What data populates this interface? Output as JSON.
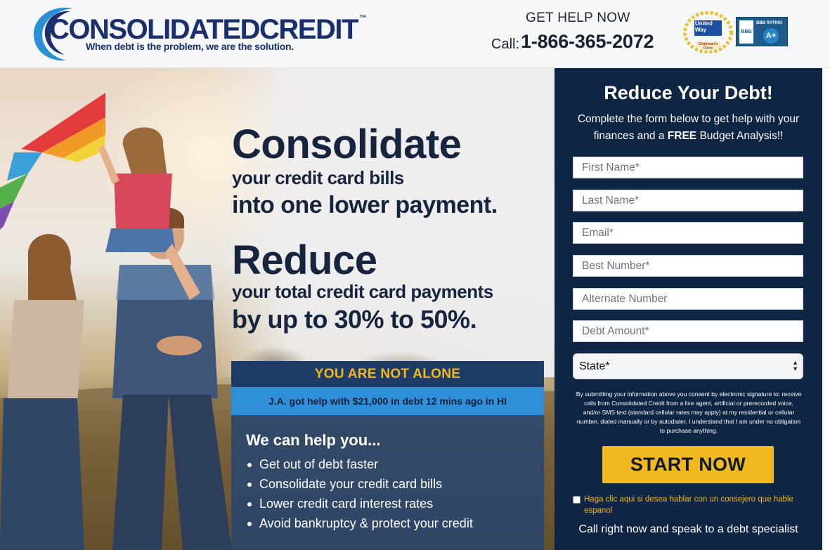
{
  "header": {
    "logo_name": "CONSOLIDATEDCREDIT",
    "logo_tm": "™",
    "logo_tagline": "When debt is the problem, we are the solution.",
    "help_label": "GET HELP NOW",
    "call_label": "Call:",
    "phone": "1-866-365-2072",
    "badges": {
      "united_way_top": "United",
      "united_way_bottom": "Way",
      "united_way_ribbon": "Chairman's Circle",
      "bbb_logo": "BBB",
      "bbb_rating_label": "BBB RATING",
      "bbb_grade": "A+"
    }
  },
  "hero": {
    "headline1": "Consolidate",
    "line1": "your credit card bills",
    "line2": "into one lower payment.",
    "headline2": "Reduce",
    "line3": "your total credit card payments",
    "line4": "by up to 30% to 50%."
  },
  "alone_box": {
    "title": "YOU ARE NOT ALONE",
    "ticker": "J.A. got help with $21,000 in debt 12 mins ago in HI",
    "help_title": "We can help you...",
    "items": [
      "Get out of debt faster",
      "Consolidate your credit card bills",
      "Lower credit card interest rates",
      "Avoid bankruptcy & protect your credit"
    ]
  },
  "form": {
    "title": "Reduce Your Debt!",
    "sub_prefix": "Complete the form below to get help with your finances and a",
    "sub_bold": "FREE",
    "sub_suffix": "Budget Analysis!!",
    "placeholders": {
      "first_name": "First Name*",
      "last_name": "Last Name*",
      "email": "Email*",
      "best_number": "Best Number*",
      "alternate_number": "Alternate Number",
      "debt_amount": "Debt Amount*"
    },
    "state_value": "State*",
    "consent": "By submitting your information above you consent by electronic signature to: receive calls from Consolidated Credit from a live agent, artificial or prerecorded voice, and/or SMS text (standard cellular rates may apply) at my residential or cellular number, dialed manually or by autodialer. I understand that I am under no obligation to purchase anything.",
    "submit_label": "START NOW",
    "spanish_label": "Haga clic aqui si desea hablar con un consejero que hable espanol",
    "call_now": "Call right now and speak to a debt specialist"
  },
  "colors": {
    "navy": "#0f2544",
    "accent_gold": "#f2b820",
    "ticker_blue": "#2f8fd8",
    "brand_blue": "#1b2f6e"
  }
}
